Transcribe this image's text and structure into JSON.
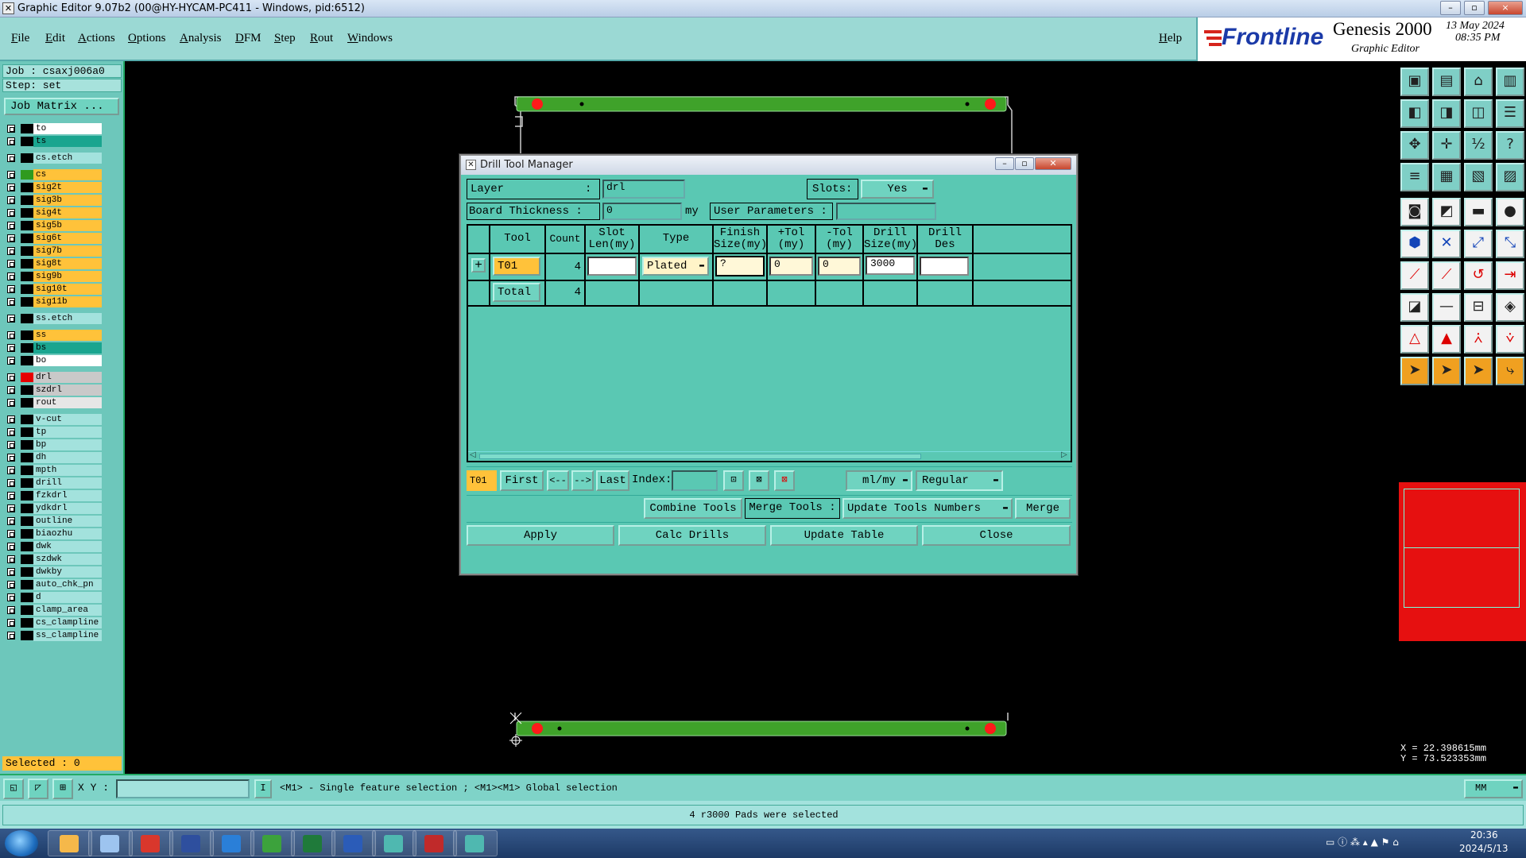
{
  "window": {
    "title": "Graphic Editor 9.07b2 (00@HY-HYCAM-PC411 - Windows, pid:6512)",
    "controls": [
      "–",
      "▫",
      "×"
    ]
  },
  "menu": [
    "File",
    "Edit",
    "Actions",
    "Options",
    "Analysis",
    "DFM",
    "Step",
    "Rout",
    "Windows"
  ],
  "help_label": "Help",
  "brand": {
    "logo": "Frontline",
    "product": "Genesis 2000",
    "subtitle": "Graphic Editor",
    "date": "13 May 2024",
    "time": "08:35 PM"
  },
  "job": {
    "job_line": "Job : csaxj006a0",
    "step_line": "Step: set",
    "job_matrix_button": "Job Matrix ..."
  },
  "layers": [
    {
      "name": "to",
      "color": "#ffffff",
      "swatch": "#000000"
    },
    {
      "name": "ts",
      "color": "#1aa58f",
      "swatch": "#000000"
    },
    {
      "name": "cs.etch",
      "color": "#a3e2dd",
      "swatch": "#000000"
    },
    {
      "name": "cs",
      "color": "#ffc23a",
      "swatch": "#2f9a1f"
    },
    {
      "name": "sig2t",
      "color": "#ffc23a",
      "swatch": "#000000"
    },
    {
      "name": "sig3b",
      "color": "#ffc23a",
      "swatch": "#000000"
    },
    {
      "name": "sig4t",
      "color": "#ffc23a",
      "swatch": "#000000"
    },
    {
      "name": "sig5b",
      "color": "#ffc23a",
      "swatch": "#000000"
    },
    {
      "name": "sig6t",
      "color": "#ffc23a",
      "swatch": "#000000"
    },
    {
      "name": "sig7b",
      "color": "#ffc23a",
      "swatch": "#000000"
    },
    {
      "name": "sig8t",
      "color": "#ffc23a",
      "swatch": "#000000"
    },
    {
      "name": "sig9b",
      "color": "#ffc23a",
      "swatch": "#000000"
    },
    {
      "name": "sig10t",
      "color": "#ffc23a",
      "swatch": "#000000"
    },
    {
      "name": "sig11b",
      "color": "#ffc23a",
      "swatch": "#000000"
    },
    {
      "name": "ss.etch",
      "color": "#a3e2dd",
      "swatch": "#000000"
    },
    {
      "name": "ss",
      "color": "#ffc23a",
      "swatch": "#000000"
    },
    {
      "name": "bs",
      "color": "#1aa58f",
      "swatch": "#000000"
    },
    {
      "name": "bo",
      "color": "#ffffff",
      "swatch": "#000000"
    },
    {
      "name": "drl",
      "color": "#c9c9c9",
      "swatch": "#e60000"
    },
    {
      "name": "szdrl",
      "color": "#c9c9c9",
      "swatch": "#000000"
    },
    {
      "name": "rout",
      "color": "#e6e6e6",
      "swatch": "#000000"
    },
    {
      "name": "v-cut",
      "color": "#a3e2dd",
      "swatch": "#000000"
    },
    {
      "name": "tp",
      "color": "#a3e2dd",
      "swatch": "#000000"
    },
    {
      "name": "bp",
      "color": "#a3e2dd",
      "swatch": "#000000"
    },
    {
      "name": "dh",
      "color": "#a3e2dd",
      "swatch": "#000000"
    },
    {
      "name": "mpth",
      "color": "#a3e2dd",
      "swatch": "#000000"
    },
    {
      "name": "drill",
      "color": "#a3e2dd",
      "swatch": "#000000"
    },
    {
      "name": "fzkdrl",
      "color": "#a3e2dd",
      "swatch": "#000000"
    },
    {
      "name": "ydkdrl",
      "color": "#a3e2dd",
      "swatch": "#000000"
    },
    {
      "name": "outline",
      "color": "#a3e2dd",
      "swatch": "#000000"
    },
    {
      "name": "biaozhu",
      "color": "#a3e2dd",
      "swatch": "#000000"
    },
    {
      "name": "dwk",
      "color": "#a3e2dd",
      "swatch": "#000000"
    },
    {
      "name": "szdwk",
      "color": "#a3e2dd",
      "swatch": "#000000"
    },
    {
      "name": "dwkby",
      "color": "#a3e2dd",
      "swatch": "#000000"
    },
    {
      "name": "auto_chk_pn",
      "color": "#a3e2dd",
      "swatch": "#000000"
    },
    {
      "name": "d",
      "color": "#a3e2dd",
      "swatch": "#000000"
    },
    {
      "name": "clamp_area",
      "color": "#a3e2dd",
      "swatch": "#000000"
    },
    {
      "name": "cs_clampline",
      "color": "#a3e2dd",
      "swatch": "#000000"
    },
    {
      "name": "ss_clampline",
      "color": "#a3e2dd",
      "swatch": "#000000"
    }
  ],
  "selected_line": "Selected : 0",
  "dialog": {
    "title": "Drill Tool Manager",
    "layer_label": "Layer",
    "layer_colon": ":",
    "layer_value": "drl",
    "slots_label": "Slots:",
    "slots_value": "Yes",
    "board_thickness_label": "Board Thickness :",
    "board_thickness_value": "0",
    "board_thickness_unit": "my",
    "user_params_label": "User Parameters :",
    "user_params_value": "",
    "columns": [
      "Tool",
      "Count",
      "Slot Len(my)",
      "Type",
      "Finish Size(my)",
      "+Tol (my)",
      "-Tol (my)",
      "Drill Size(my)",
      "Drill Des"
    ],
    "rows": [
      {
        "expander": "+",
        "tool": "T01",
        "count": "4",
        "slot_len": "",
        "type": "Plated",
        "finish": "?",
        "plus_tol": "0",
        "minus_tol": "0",
        "drill_size": "3000",
        "drill_des": ""
      }
    ],
    "total": {
      "label": "Total",
      "count": "4"
    },
    "nav": {
      "current": "T01",
      "first": "First",
      "prev": "<--",
      "next": "-->",
      "last": "Last",
      "index_label": "Index:",
      "index_value": "",
      "units": "ml/my",
      "mode": "Regular"
    },
    "combine_tools": "Combine Tools",
    "merge_tools_label": "Merge Tools :",
    "update_numbers": "Update Tools Numbers",
    "merge": "Merge",
    "apply": "Apply",
    "calc_drills": "Calc Drills",
    "update_table": "Update Table",
    "close": "Close"
  },
  "coords": {
    "x": "X = 22.398615mm",
    "y": "Y = 73.523353mm"
  },
  "command": {
    "xy_label": "X Y :",
    "xy_value": "",
    "hint": "<M1> - Single feature selection ; <M1><M1> Global selection",
    "units": "MM"
  },
  "status": "4 r3000 Pads were selected",
  "tray": {
    "time": "20:36",
    "date": "2024/5/13"
  },
  "taskbar_apps": [
    "start",
    "app-shell",
    "notepad",
    "app-red",
    "floppy",
    "app-blue",
    "app-green",
    "excel",
    "word",
    "app-eye",
    "genesis",
    "app-eye2"
  ]
}
